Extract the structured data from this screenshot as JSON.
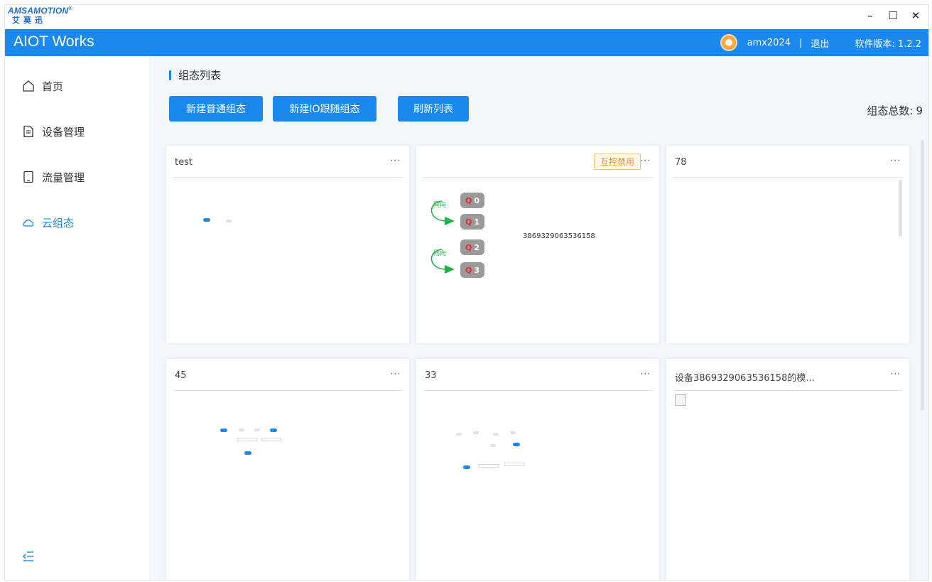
{
  "titlebar": {
    "logo_brand": "AMSAMOTION",
    "logo_reg": "®",
    "logo_cn": "艾莫迅",
    "minimize": "–",
    "maximize": "☐",
    "close": "✕"
  },
  "header": {
    "app_title": "AIOT Works",
    "username": "amx2024",
    "separator": "|",
    "logout": "退出",
    "version": "软件版本: 1.2.2",
    "accent": "#1b88ee"
  },
  "sidebar": {
    "items": [
      {
        "label": "首页",
        "icon": "home-icon"
      },
      {
        "label": "设备管理",
        "icon": "document-icon"
      },
      {
        "label": "流量管理",
        "icon": "phone-icon"
      },
      {
        "label": "云组态",
        "icon": "cloud-icon"
      }
    ],
    "collapse_icon": "collapse-menu-icon"
  },
  "main": {
    "heading": "组态列表",
    "buttons": {
      "new_normal": "新建普通组态",
      "new_io": "新建IO跟随组态",
      "refresh": "刷新列表"
    },
    "count_label": "组态总数:",
    "count_value": "9"
  },
  "cards": [
    {
      "title": "test",
      "more": "···"
    },
    {
      "title": "",
      "more": "···",
      "tag": "互控禁用",
      "device_id": "3869329063536158",
      "nodes": [
        "0",
        "1",
        "2",
        "3"
      ],
      "node_prefix": "Q",
      "link_label": "同向"
    },
    {
      "title": "78",
      "more": "···"
    },
    {
      "title": "45",
      "more": "···"
    },
    {
      "title": "33",
      "more": "···"
    },
    {
      "title": "设备3869329063536158的模...",
      "more": "···"
    }
  ]
}
